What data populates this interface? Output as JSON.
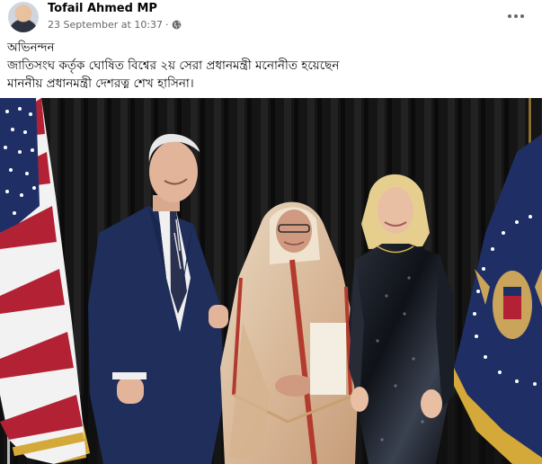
{
  "post": {
    "author": "Tofail Ahmed MP",
    "timestamp": "23 September at 10:37",
    "separator": "·",
    "privacy_icon": "globe-icon",
    "more_icon": "more-options-icon",
    "caption_lines": [
      "অভিনন্দন",
      "জাতিসংঘ কর্তৃক ঘোষিত বিশ্বের ২য় সেরা প্রধানমন্ত্রী মনোনীত হয়েছেন",
      "মাননীয় প্রধানমন্ত্রী দেশরত্ন শেখ হাসিনা।"
    ]
  },
  "colors": {
    "name_text": "#050505",
    "meta_text": "#65676b",
    "curtain": "#141414",
    "flag_red": "#b22234",
    "flag_blue": "#1f2f66",
    "flag_fringe": "#d4a93a"
  }
}
